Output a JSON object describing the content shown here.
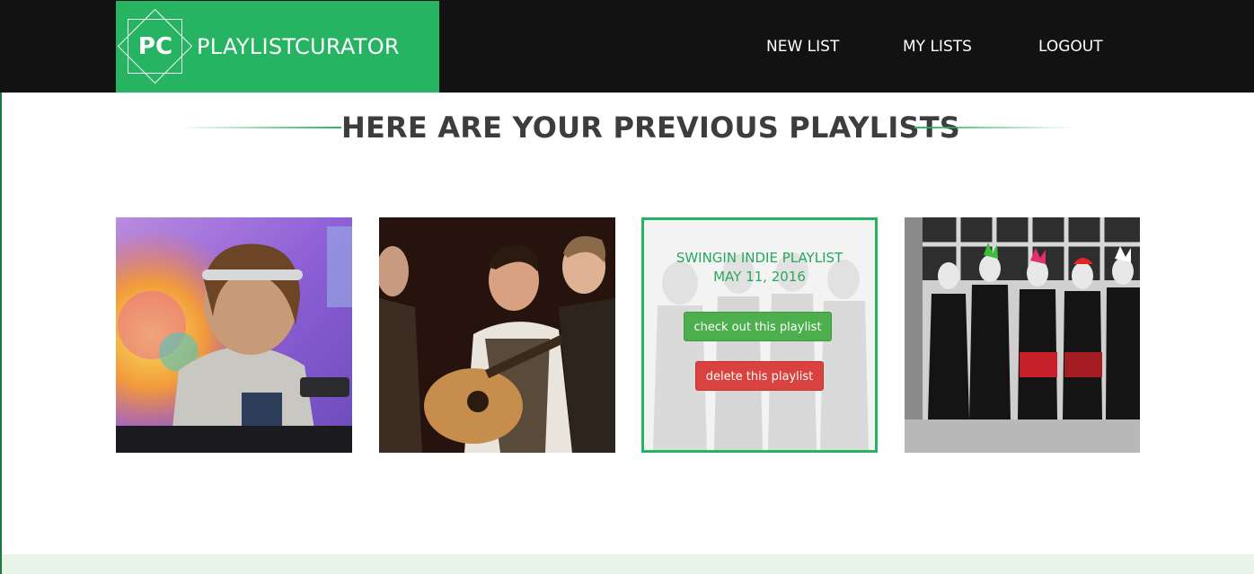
{
  "brand": {
    "logo_text": "PC",
    "name": "PLAYLISTCURATOR"
  },
  "nav": {
    "new_list": "NEW LIST",
    "my_lists": "MY LISTS",
    "logout": "LOGOUT"
  },
  "main": {
    "heading": "HERE ARE YOUR PREVIOUS PLAYLISTS"
  },
  "cards": [
    {
      "image": "dj-headphones-photo"
    },
    {
      "image": "folk-band-guitar-photo"
    },
    {
      "image": "indie-band-photo",
      "title": "SWINGIN INDIE PLAYLIST",
      "date": "MAY 11, 2016",
      "view_label": "check out this playlist",
      "delete_label": "delete this playlist"
    },
    {
      "image": "punk-group-bw-photo"
    }
  ],
  "colors": {
    "accent": "#27b462",
    "navbar": "#121212",
    "danger": "#d9423e",
    "success": "#4cae4c"
  }
}
